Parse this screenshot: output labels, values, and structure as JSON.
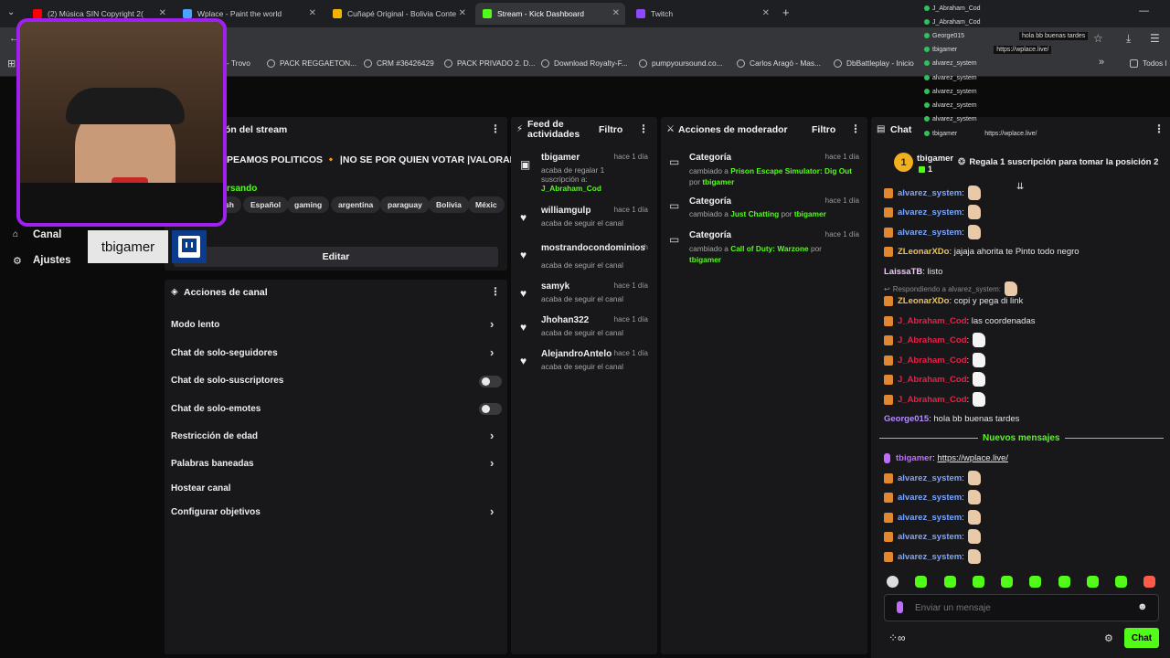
{
  "browser": {
    "tabs": [
      {
        "label": "(2) Música SIN Copyright 2(",
        "color": "#ff0000",
        "active": false
      },
      {
        "label": "Wplace - Paint the world",
        "color": "#4aa3ff",
        "active": false
      },
      {
        "label": "Cuñapé Original - Bolivia Conte",
        "color": "#f4b400",
        "active": false
      },
      {
        "label": "Stream - Kick Dashboard",
        "color": "#53fc18",
        "active": true
      },
      {
        "label": "Twitch",
        "color": "#9146ff",
        "active": false
      }
    ],
    "new_tab": "+",
    "bookmarks": [
      "- Trovo",
      "PACK REGGAETON...",
      "CRM #36426429",
      "PACK PRIVADO 2. D...",
      "Download Royalty-F...",
      "pumpyoursound.co...",
      "Carlos Aragó - Mas...",
      "DbBattleplay - Inicio"
    ],
    "all_bookmarks": "Todos l"
  },
  "overlay": {
    "streamer_name": "tbigamer",
    "chat_lines": [
      {
        "user": "J_Abraham_Cod",
        "msg": ""
      },
      {
        "user": "J_Abraham_Cod",
        "msg": ""
      },
      {
        "user": "George015",
        "msg": "hola bb buenas tardes"
      },
      {
        "user": "tbigamer",
        "msg": "https://wplace.live/"
      },
      {
        "user": "alvarez_system",
        "msg": ""
      },
      {
        "user": "alvarez_system",
        "msg": ""
      },
      {
        "user": "alvarez_system",
        "msg": ""
      },
      {
        "user": "alvarez_system",
        "msg": ""
      },
      {
        "user": "alvarez_system",
        "msg": ""
      },
      {
        "user": "alvarez_system",
        "msg": ""
      },
      {
        "user": "tbigamer",
        "msg": "https://wplace.live/"
      }
    ]
  },
  "sidebar": {
    "items": [
      {
        "label": "Canal",
        "icon": "home-icon"
      },
      {
        "label": "Ajustes",
        "icon": "gear-icon"
      }
    ]
  },
  "stream_info": {
    "title_partial": "ón del stream",
    "stream_title": "PEAMOS POLITICOS 🔸 |NO SE POR QUIEN VOTAR |VALORANT|",
    "category_partial": "rsando",
    "tags": [
      "sh",
      "Español",
      "gaming",
      "argentina",
      "paraguay",
      "Bolivia",
      "Méxic"
    ],
    "edit_button": "Editar"
  },
  "channel_actions": {
    "title": "Acciones de canal",
    "items": [
      {
        "label": "Modo lento",
        "control": "chevron"
      },
      {
        "label": "Chat de solo-seguidores",
        "control": "chevron"
      },
      {
        "label": "Chat de solo-suscriptores",
        "control": "toggle"
      },
      {
        "label": "Chat de solo-emotes",
        "control": "toggle"
      },
      {
        "label": "Restricción de edad",
        "control": "chevron"
      },
      {
        "label": "Palabras baneadas",
        "control": "chevron"
      },
      {
        "label": "Hostear canal",
        "control": "none"
      },
      {
        "label": "Configurar objetivos",
        "control": "chevron"
      }
    ]
  },
  "activity_feed": {
    "title_line1": "Feed de",
    "title_line2": "actividades",
    "filter": "Filtro",
    "items": [
      {
        "name": "tbigamer",
        "time": "hace 1 día",
        "line1": "acaba de regalar 1",
        "line2": "suscripción a:",
        "target": "J_Abraham_Cod",
        "icon": "gift-icon"
      },
      {
        "name": "williamgulp",
        "time": "hace 1 día",
        "line1": "acaba de seguir el canal",
        "icon": "heart-icon"
      },
      {
        "name": "mostrandocondominios",
        "time": "h",
        "line1": "acaba de seguir el canal",
        "icon": "heart-icon"
      },
      {
        "name": "samyk",
        "time": "hace 1 día",
        "line1": "acaba de seguir el canal",
        "icon": "heart-icon"
      },
      {
        "name": "Jhohan322",
        "time": "hace 1 día",
        "line1": "acaba de seguir el canal",
        "icon": "heart-icon"
      },
      {
        "name": "AlejandroAntelo",
        "time": "hace 1 día",
        "line1": "acaba de seguir el canal",
        "icon": "heart-icon"
      }
    ]
  },
  "mod_actions": {
    "title": "Acciones de moderador",
    "filter": "Filtro",
    "items": [
      {
        "label": "Categoría",
        "time": "hace 1 día",
        "pre": "cambiado a ",
        "value": "Prison Escape Simulator: Dig Out",
        "by_word": "por",
        "by": "tbigamer"
      },
      {
        "label": "Categoría",
        "time": "hace 1 día",
        "pre": "cambiado a ",
        "value": "Just Chatting",
        "by_word": "por",
        "by": "tbigamer"
      },
      {
        "label": "Categoría",
        "time": "hace 1 día",
        "pre": "cambiado a ",
        "value": "Call of Duty: Warzone",
        "by_word": "por",
        "by": "tbigamer"
      }
    ]
  },
  "chat": {
    "title": "Chat",
    "top_gifter": {
      "name": "tbigamer",
      "count": "1",
      "rank": "1"
    },
    "gift_prompt": "Regala 1 suscripción para tomar la posición 2",
    "messages": [
      {
        "user": "alvarez_system",
        "color": "#7aa6ff",
        "text": ":",
        "emote": "thumb"
      },
      {
        "user": "alvarez_system",
        "color": "#7aa6ff",
        "text": ":",
        "emote": "thumb"
      },
      {
        "user": "ZLeonarXDo",
        "color": "#f2c14e",
        "text": ": jajaja ahorita te Pinto todo negro",
        "emote": ""
      },
      {
        "user": "LaissaTB",
        "color": "#f0c7ff",
        "text": ": listo",
        "emote": ""
      },
      {
        "user": "Respondiendo a alvarez_system:",
        "color": "#8a8a8a",
        "text": "",
        "emote": "thumb",
        "reply": true
      },
      {
        "user": "ZLeonarXDo",
        "color": "#f2c14e",
        "text": ": copi y pega di link",
        "emote": ""
      },
      {
        "user": "J_Abraham_Cod",
        "color": "#e0244a",
        "text": ": las coordenadas",
        "emote": ""
      },
      {
        "user": "J_Abraham_Cod",
        "color": "#e0244a",
        "text": ":",
        "emote": "white"
      },
      {
        "user": "J_Abraham_Cod",
        "color": "#e0244a",
        "text": ":",
        "emote": "white"
      },
      {
        "user": "J_Abraham_Cod",
        "color": "#e0244a",
        "text": ":",
        "emote": "white"
      },
      {
        "user": "J_Abraham_Cod",
        "color": "#e0244a",
        "text": ":",
        "emote": "white"
      },
      {
        "user": "George015",
        "color": "#b48cff",
        "text": ": hola bb buenas tardes",
        "emote": ""
      }
    ],
    "new_messages": "Nuevos mensajes",
    "new": [
      {
        "user": "tbigamer",
        "color": "#c06cff",
        "text": ":",
        "link": "https://wplace.live/",
        "emote": ""
      },
      {
        "user": "alvarez_system",
        "color": "#7aa6ff",
        "text": ":",
        "emote": "thumb"
      },
      {
        "user": "alvarez_system",
        "color": "#7aa6ff",
        "text": ":",
        "emote": "thumb"
      },
      {
        "user": "alvarez_system",
        "color": "#7aa6ff",
        "text": ":",
        "emote": "thumb"
      },
      {
        "user": "alvarez_system",
        "color": "#7aa6ff",
        "text": ":",
        "emote": "thumb"
      },
      {
        "user": "alvarez_system",
        "color": "#7aa6ff",
        "text": ":",
        "emote": "thumb"
      }
    ],
    "input_placeholder": "Enviar un mensaje",
    "send_button": "Chat"
  },
  "colors": {
    "kick_green": "#53fc18",
    "panel": "#18181b",
    "bg": "#0b0b0c",
    "twitch_purple": "#9146ff"
  }
}
